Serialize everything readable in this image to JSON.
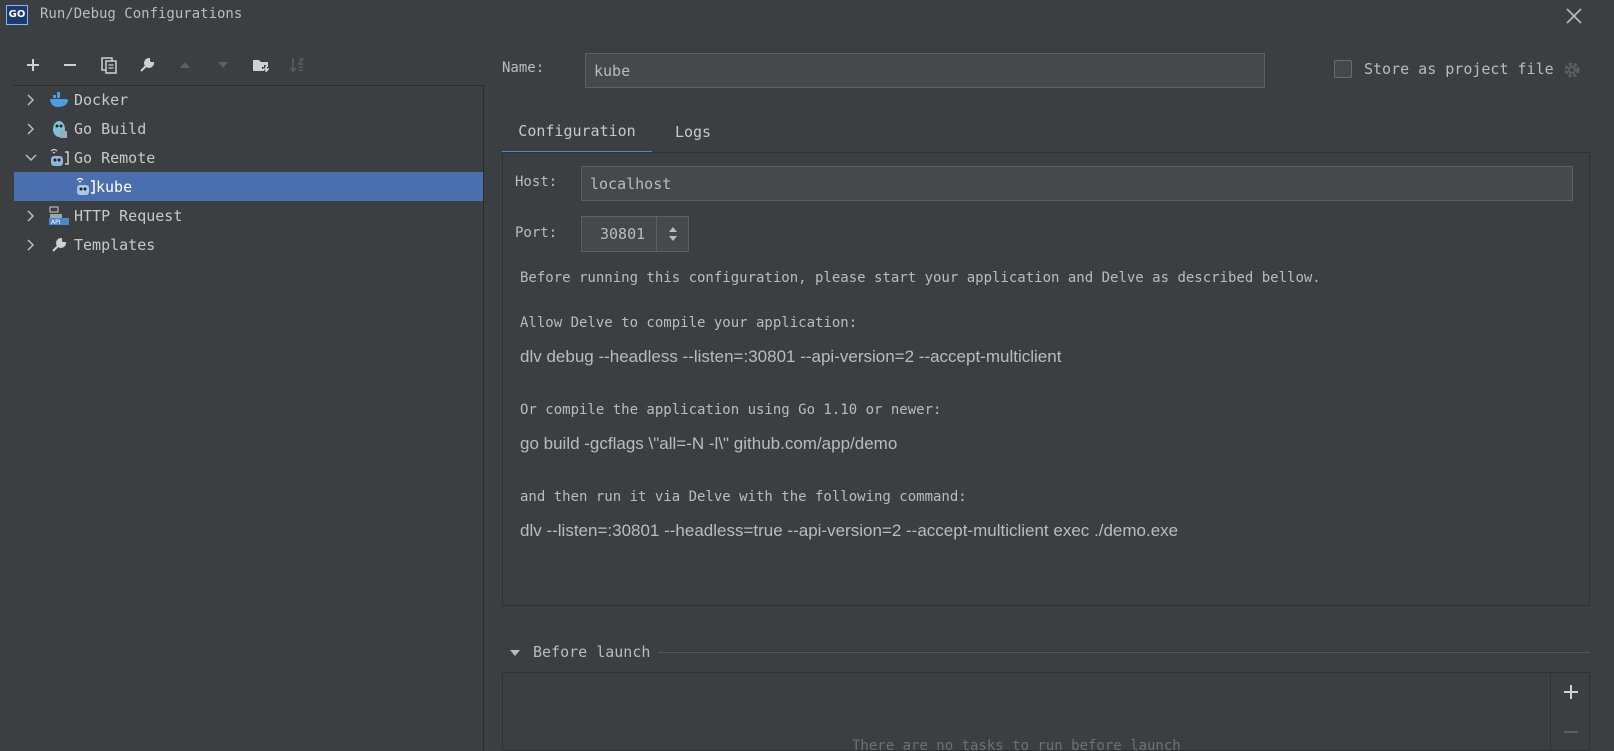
{
  "window": {
    "title": "Run/Debug Configurations",
    "logo_text": "GO"
  },
  "toolbar": {
    "add": "+",
    "remove": "−"
  },
  "tree": {
    "items": [
      {
        "label": "Docker",
        "icon": "docker-icon",
        "expanded": false
      },
      {
        "label": "Go Build",
        "icon": "go-build-icon",
        "expanded": false
      },
      {
        "label": "Go Remote",
        "icon": "go-remote-icon",
        "expanded": true
      },
      {
        "label": "kube",
        "icon": "go-remote-icon",
        "selected": true
      },
      {
        "label": "HTTP Request",
        "icon": "api-icon",
        "expanded": false
      },
      {
        "label": "Templates",
        "icon": "wrench-icon",
        "expanded": false
      }
    ]
  },
  "form": {
    "name_label": "Name:",
    "name_value": "kube",
    "store_label": "Store as project file",
    "tabs": [
      {
        "label": "Configuration"
      },
      {
        "label": "Logs"
      }
    ],
    "host_label": "Host:",
    "host_value": "localhost",
    "port_label": "Port:",
    "port_value": "30801"
  },
  "instructions": {
    "intro": "Before running this configuration, please start your application and Delve as described bellow.",
    "allow": "Allow Delve to compile your application:",
    "cmd1": "dlv debug --headless --listen=:30801 --api-version=2 --accept-multiclient",
    "or": "Or compile the application using Go 1.10 or newer:",
    "cmd2": "go build -gcflags \\\"all=-N -l\\\" github.com/app/demo",
    "then": "and then run it via Delve with the following command:",
    "cmd3": "dlv --listen=:30801 --headless=true --api-version=2 --accept-multiclient exec ./demo.exe"
  },
  "before_launch": {
    "title": "Before launch",
    "empty_text": "There are no tasks to run before launch",
    "add": "+",
    "remove": "−"
  },
  "colors": {
    "selection": "#4b6eaf",
    "tab_underline": "#4a88c7",
    "background": "#3c3f41"
  }
}
